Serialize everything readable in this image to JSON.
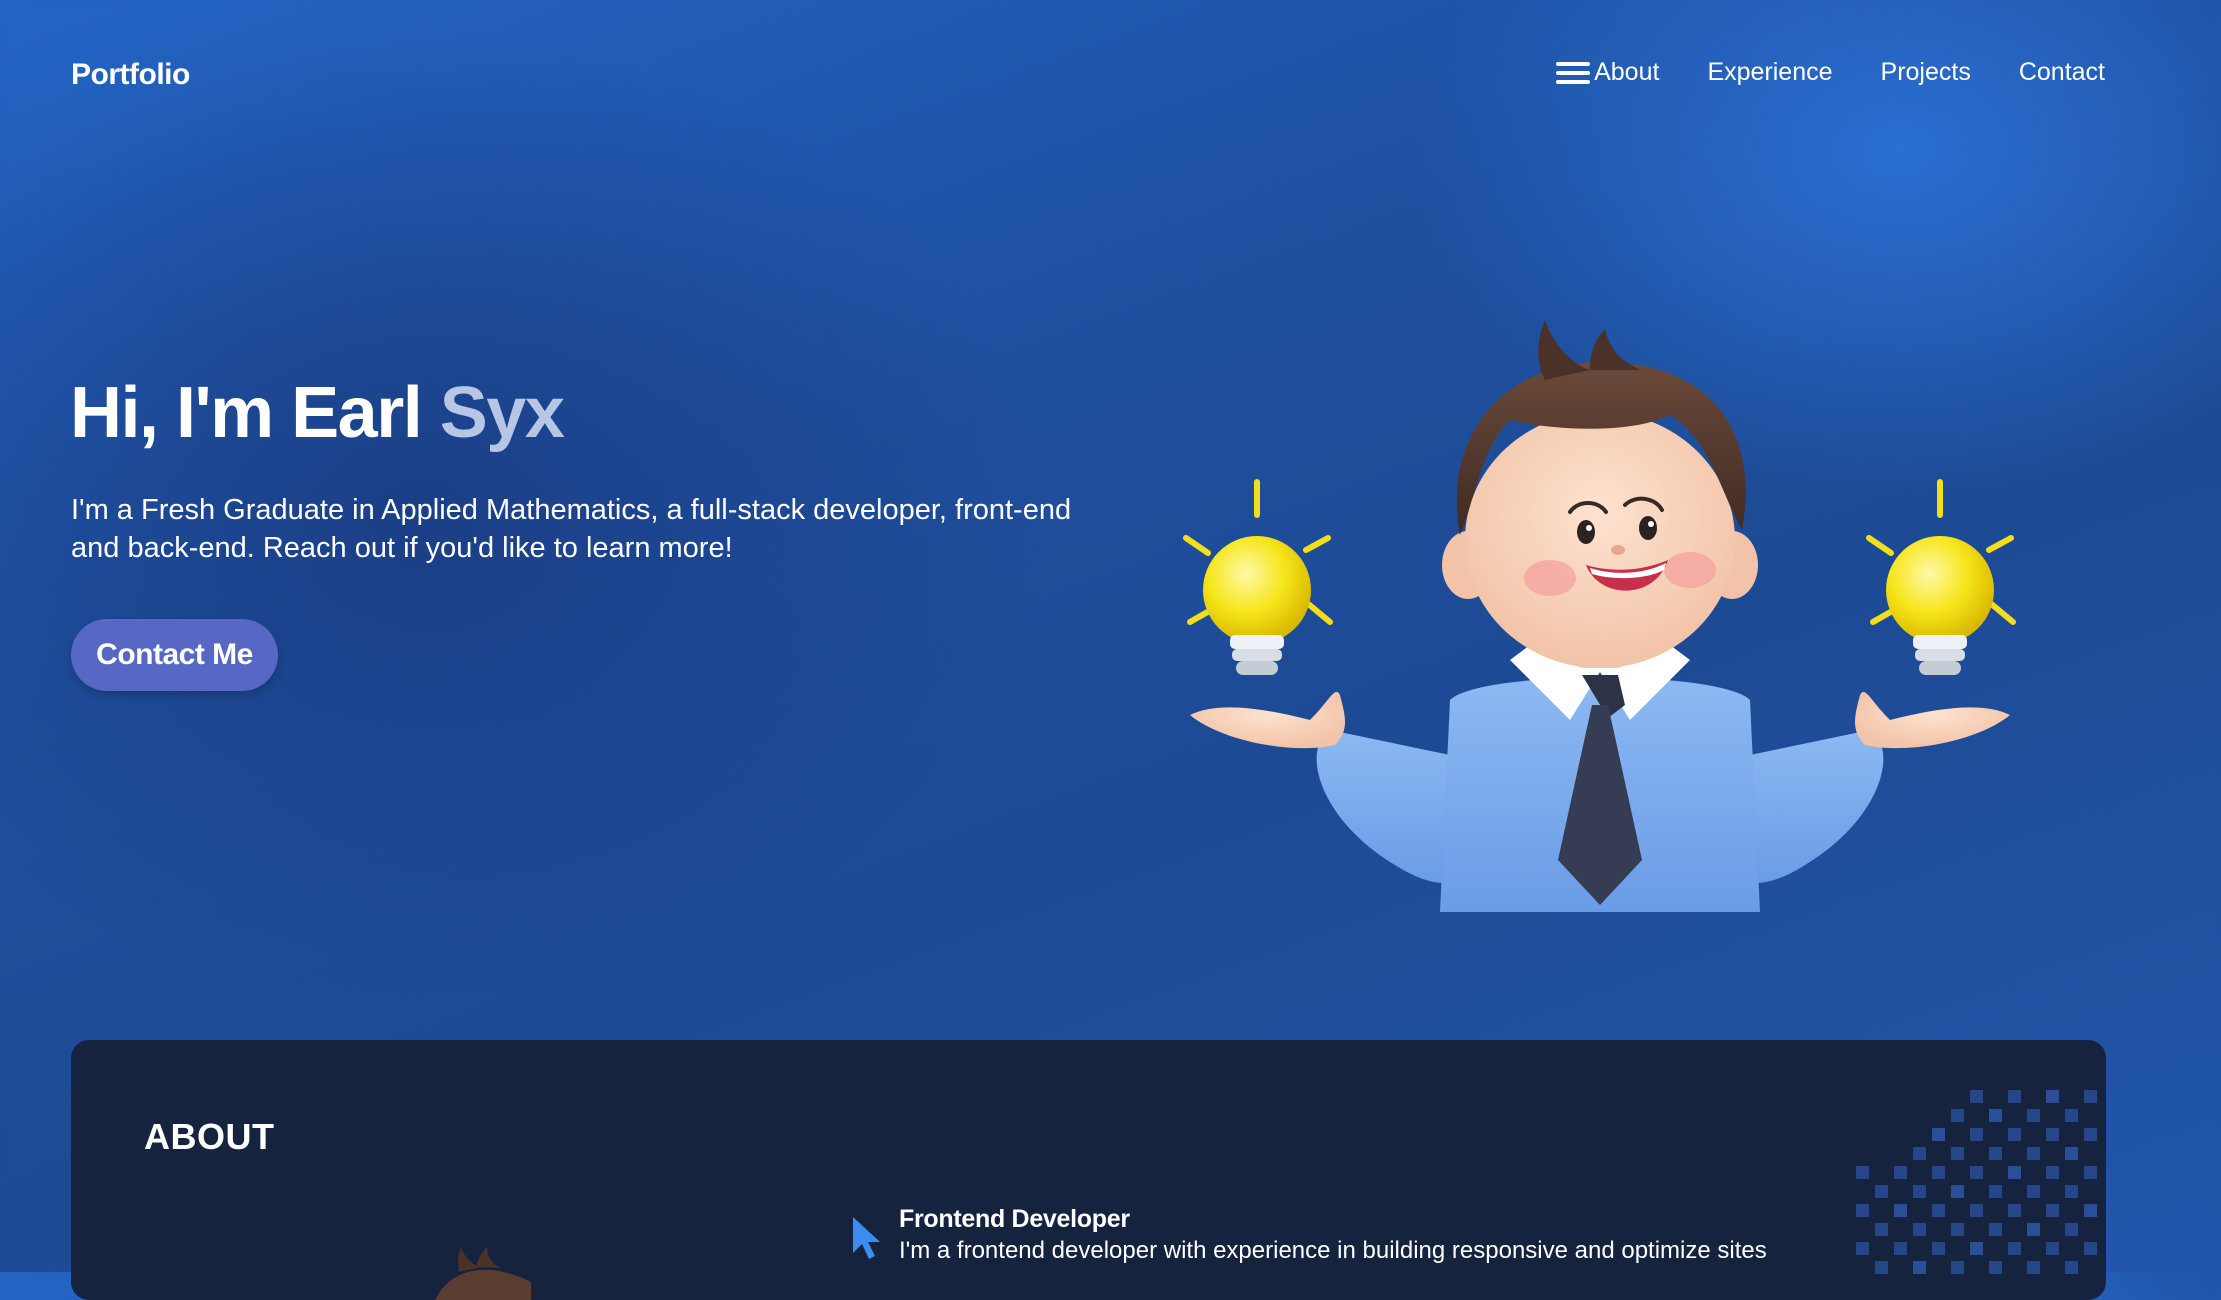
{
  "nav": {
    "logo": "Portfolio",
    "menu_icon": "hamburger-icon",
    "links": [
      "About",
      "Experience",
      "Projects",
      "Contact"
    ]
  },
  "hero": {
    "greeting": "Hi, I'm Earl ",
    "name_accent": "Syx",
    "description": "I'm a Fresh Graduate in Applied Mathematics, a full-stack developer, front-end and back-end. Reach out if you'd like to learn more!",
    "cta_label": "Contact Me",
    "illustration": "developer-with-lightbulbs-illustration"
  },
  "about": {
    "title": "ABOUT",
    "item": {
      "icon": "cursor-icon",
      "title": "Frontend Developer",
      "description": "I'm a frontend developer with experience in building responsive and optimize sites"
    }
  },
  "colors": {
    "background": "#1f52a3",
    "accent_text": "#b6c6e4",
    "button": "#5768c4",
    "card": "#15233f",
    "cursor": "#3b8ef0"
  }
}
